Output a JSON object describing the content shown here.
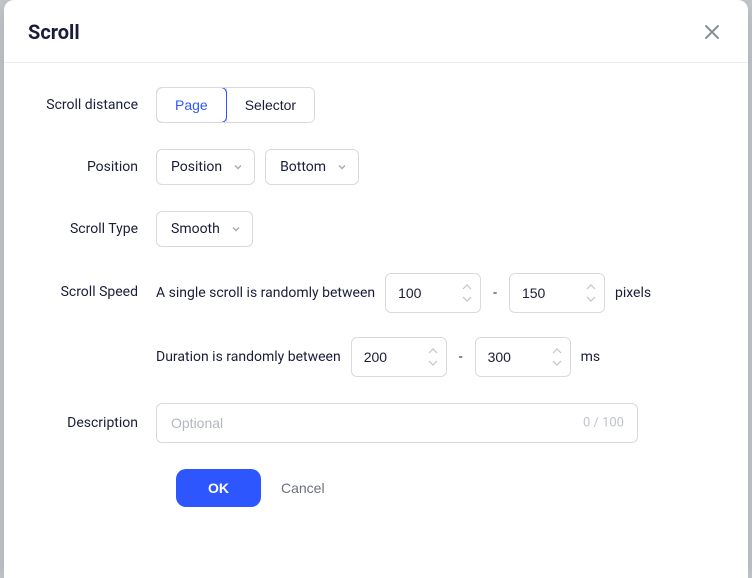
{
  "modal": {
    "title": "Scroll"
  },
  "labels": {
    "scrollDistance": "Scroll distance",
    "position": "Position",
    "scrollType": "Scroll Type",
    "scrollSpeed": "Scroll Speed",
    "description": "Description"
  },
  "scrollDistance": {
    "page": "Page",
    "selector": "Selector"
  },
  "position": {
    "select1": "Position",
    "select2": "Bottom"
  },
  "scrollType": {
    "value": "Smooth"
  },
  "scrollSpeed": {
    "text1": "A single scroll is randomly between",
    "min": "100",
    "max": "150",
    "unit1": "pixels",
    "text2": "Duration is randomly between",
    "dmin": "200",
    "dmax": "300",
    "unit2": "ms",
    "dash": "-"
  },
  "description": {
    "placeholder": "Optional",
    "counter": "0 / 100"
  },
  "footer": {
    "ok": "OK",
    "cancel": "Cancel"
  }
}
